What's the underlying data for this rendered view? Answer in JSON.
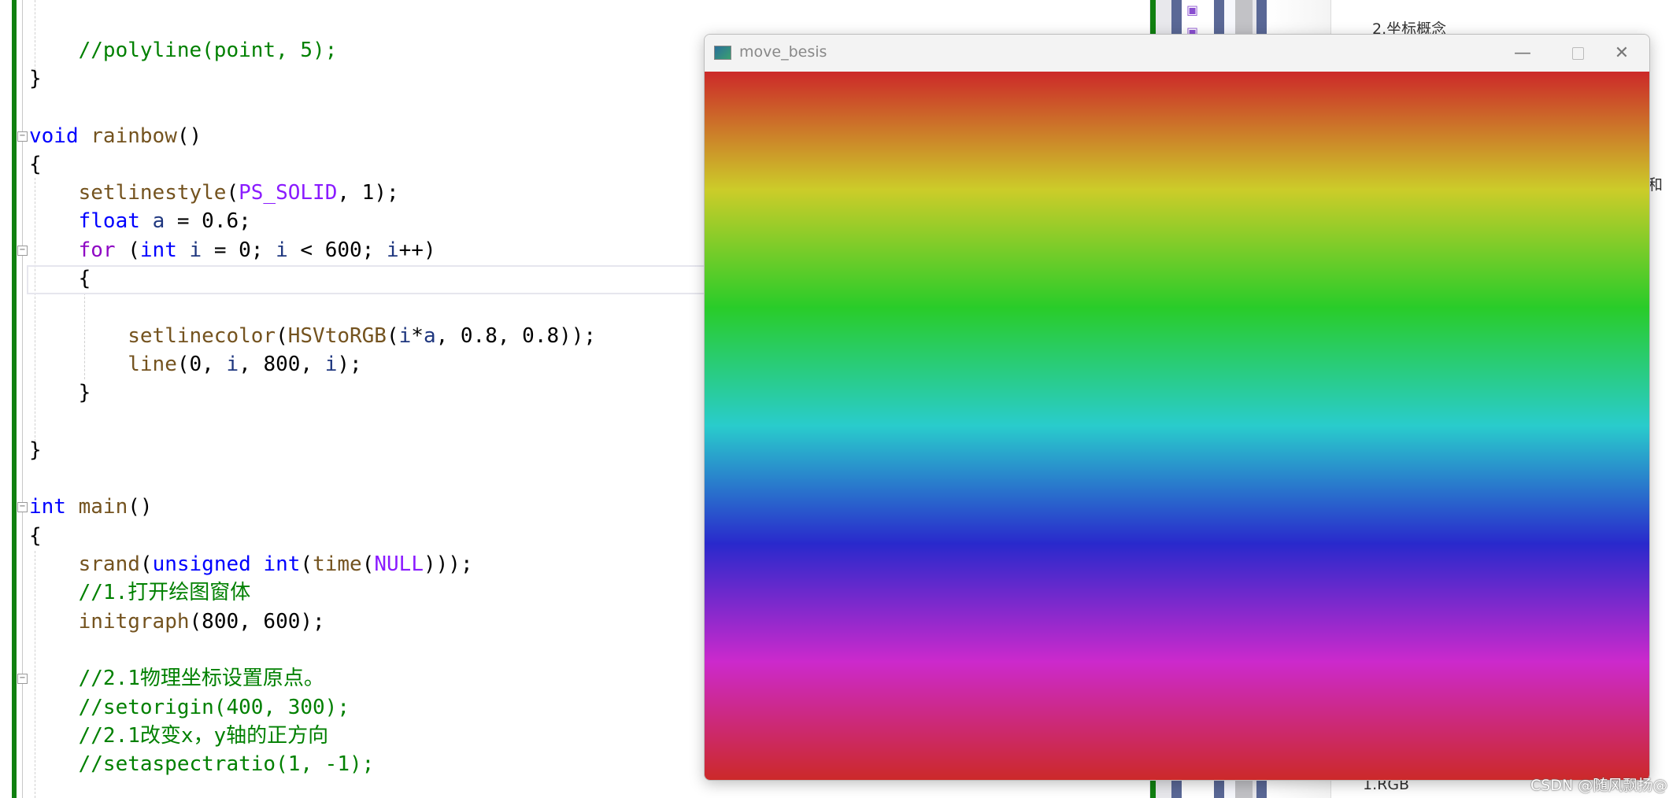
{
  "editor": {
    "lines": [
      {
        "row": 2,
        "tokens": [
          [
            "cm",
            "    //polyline(point, 5);"
          ]
        ]
      },
      {
        "row": 3,
        "tokens": [
          [
            "pl",
            "}"
          ]
        ]
      },
      {
        "row": 5,
        "tokens": [
          [
            "kw",
            "void"
          ],
          [
            "pl",
            " "
          ],
          [
            "fn",
            "rainbow"
          ],
          [
            "pl",
            "()"
          ]
        ]
      },
      {
        "row": 6,
        "tokens": [
          [
            "pl",
            "{"
          ]
        ]
      },
      {
        "row": 7,
        "tokens": [
          [
            "pl",
            "    "
          ],
          [
            "fn",
            "setlinestyle"
          ],
          [
            "pl",
            "("
          ],
          [
            "mac",
            "PS_SOLID"
          ],
          [
            "pl",
            ", 1);"
          ]
        ]
      },
      {
        "row": 8,
        "tokens": [
          [
            "pl",
            "    "
          ],
          [
            "kw",
            "float"
          ],
          [
            "pl",
            " "
          ],
          [
            "var",
            "a"
          ],
          [
            "pl",
            " = 0.6;"
          ]
        ]
      },
      {
        "row": 9,
        "tokens": [
          [
            "pl",
            "    "
          ],
          [
            "ctl",
            "for"
          ],
          [
            "pl",
            " ("
          ],
          [
            "kw",
            "int"
          ],
          [
            "pl",
            " "
          ],
          [
            "var",
            "i"
          ],
          [
            "pl",
            " = 0; "
          ],
          [
            "var",
            "i"
          ],
          [
            "pl",
            " < 600; "
          ],
          [
            "var",
            "i"
          ],
          [
            "pl",
            "++)"
          ]
        ]
      },
      {
        "row": 10,
        "tokens": [
          [
            "pl",
            "    {"
          ]
        ]
      },
      {
        "row": 12,
        "tokens": [
          [
            "pl",
            "        "
          ],
          [
            "fn",
            "setlinecolor"
          ],
          [
            "pl",
            "("
          ],
          [
            "fn",
            "HSVtoRGB"
          ],
          [
            "pl",
            "("
          ],
          [
            "var",
            "i"
          ],
          [
            "pl",
            "*"
          ],
          [
            "var",
            "a"
          ],
          [
            "pl",
            ", 0.8, 0.8));"
          ]
        ]
      },
      {
        "row": 13,
        "tokens": [
          [
            "pl",
            "        "
          ],
          [
            "fn",
            "line"
          ],
          [
            "pl",
            "(0, "
          ],
          [
            "var",
            "i"
          ],
          [
            "pl",
            ", 800, "
          ],
          [
            "var",
            "i"
          ],
          [
            "pl",
            ");"
          ]
        ]
      },
      {
        "row": 14,
        "tokens": [
          [
            "pl",
            "    }"
          ]
        ]
      },
      {
        "row": 16,
        "tokens": [
          [
            "pl",
            "}"
          ]
        ]
      },
      {
        "row": 18,
        "tokens": [
          [
            "kw",
            "int"
          ],
          [
            "pl",
            " "
          ],
          [
            "fn",
            "main"
          ],
          [
            "pl",
            "()"
          ]
        ]
      },
      {
        "row": 19,
        "tokens": [
          [
            "pl",
            "{"
          ]
        ]
      },
      {
        "row": 20,
        "tokens": [
          [
            "pl",
            "    "
          ],
          [
            "fn",
            "srand"
          ],
          [
            "pl",
            "("
          ],
          [
            "kw",
            "unsigned"
          ],
          [
            "pl",
            " "
          ],
          [
            "kw",
            "int"
          ],
          [
            "pl",
            "("
          ],
          [
            "fn",
            "time"
          ],
          [
            "pl",
            "("
          ],
          [
            "mac",
            "NULL"
          ],
          [
            "pl",
            ")));"
          ]
        ]
      },
      {
        "row": 21,
        "tokens": [
          [
            "cm",
            "    //1.打开绘图窗体"
          ]
        ]
      },
      {
        "row": 22,
        "tokens": [
          [
            "pl",
            "    "
          ],
          [
            "fn",
            "initgraph"
          ],
          [
            "pl",
            "(800, 600);"
          ]
        ]
      },
      {
        "row": 24,
        "tokens": [
          [
            "cm",
            "    //2.1物理坐标设置原点。"
          ]
        ]
      },
      {
        "row": 25,
        "tokens": [
          [
            "cm",
            "    //setorigin(400, 300);"
          ]
        ]
      },
      {
        "row": 26,
        "tokens": [
          [
            "cm",
            "    //2.1改变x，y轴的正方向"
          ]
        ]
      },
      {
        "row": 27,
        "tokens": [
          [
            "cm",
            "    //setaspectratio(1, -1);"
          ]
        ]
      }
    ],
    "fold_rows": [
      5,
      9,
      18,
      24
    ],
    "colors": {
      "keyword": "#0000ff",
      "function": "#74531f",
      "macro": "#8a1bff",
      "comment": "#008000",
      "variable": "#1f377f",
      "control": "#8f08c4"
    }
  },
  "panel": {
    "item_top": "2.坐标概念",
    "item_cut": "和",
    "item_bottom": "1.RGB"
  },
  "window": {
    "title": "move_besis",
    "minimize_icon": "minimize-icon",
    "maximize_icon": "maximize-icon",
    "close_icon": "close-icon",
    "canvas": {
      "width": 800,
      "height": 600,
      "hue_step": 0.6,
      "saturation": 0.8,
      "value": 0.8
    }
  },
  "watermark": "CSDN @随风飘扬@"
}
